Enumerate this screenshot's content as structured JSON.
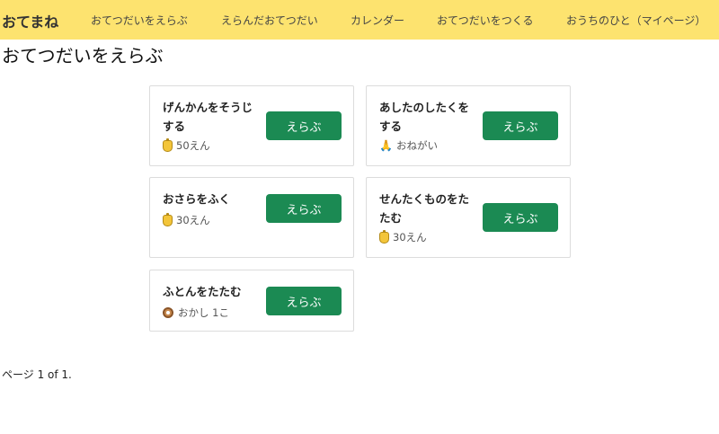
{
  "navbar": {
    "brand": "おてまね",
    "links": [
      {
        "label": "おてつだいをえらぶ"
      },
      {
        "label": "えらんだおてつだい"
      },
      {
        "label": "カレンダー"
      },
      {
        "label": "おてつだいをつくる"
      },
      {
        "label": "おうちのひと（マイページ）"
      }
    ],
    "background": "#fde36f"
  },
  "page": {
    "title": "おてつだいをえらぶ",
    "pagination": "ページ 1 of 1."
  },
  "chores": [
    {
      "title": "げんかんをそうじする",
      "reward_icon": "coin-icon",
      "reward": "50えん",
      "button": "えらぶ"
    },
    {
      "title": "あしたのしたくをする",
      "reward_icon": "praying-hands-icon",
      "reward": "おねがい",
      "button": "えらぶ"
    },
    {
      "title": "おさらをふく",
      "reward_icon": "coin-icon",
      "reward": "30えん",
      "button": "えらぶ"
    },
    {
      "title": "せんたくものをたたむ",
      "reward_icon": "coin-icon",
      "reward": "30えん",
      "button": "えらぶ"
    },
    {
      "title": "ふとんをたたむ",
      "reward_icon": "donut-icon",
      "reward": "おかし 1こ",
      "button": "えらぶ"
    }
  ],
  "colors": {
    "accent": "#1b8a53",
    "card_border": "#dcdcdc"
  }
}
